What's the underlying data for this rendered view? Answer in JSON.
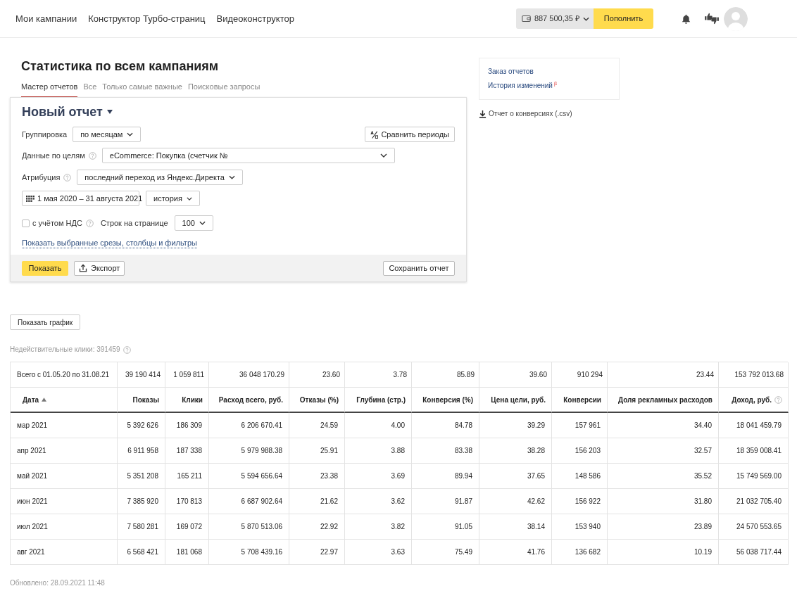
{
  "top_nav": {
    "links": [
      {
        "label": "Мои кампании"
      },
      {
        "label": "Конструктор Турбо-страниц"
      },
      {
        "label": "Видеоконструктор"
      }
    ],
    "balance": "887 500,35 ₽",
    "topup_button": "Пополнить"
  },
  "page": {
    "title": "Статистика по всем кампаниям",
    "tabs": [
      {
        "label": "Мастер отчетов",
        "selected": true
      },
      {
        "label": "Все",
        "selected": false
      },
      {
        "label": "Только самые важные",
        "selected": false
      },
      {
        "label": "Поисковые запросы",
        "selected": false
      }
    ]
  },
  "report_form": {
    "title": "Новый отчет",
    "grouping": {
      "label": "Группировка",
      "value": "по месяцам"
    },
    "compare_button": "Сравнить периоды",
    "goals": {
      "label": "Данные по целям",
      "value": "eCommerce: Покупка (счетчик №"
    },
    "attribution": {
      "label": "Атрибуция",
      "value": "последний переход из Яндекс.Директа"
    },
    "date_range": "1 мая 2020 – 31 августа 2021",
    "period_select": "история",
    "vat": {
      "label": "с учётом НДС",
      "checked": false
    },
    "rows_per_page": {
      "label": "Строк на странице",
      "value": "100"
    },
    "filters_link": "Показать выбранные срезы, столбцы и фильтры",
    "show_button": "Показать",
    "export_button": "Экспорт",
    "save_button": "Сохранить отчет"
  },
  "side_panel": {
    "links": [
      {
        "label": "Заказ отчетов"
      },
      {
        "label": "История изменений",
        "badge": "β"
      }
    ],
    "download_link": "Отчет о конверсиях (.csv)"
  },
  "show_chart_button": "Показать график",
  "invalid_clicks": "Недействительные клики: 391459",
  "table": {
    "totals": [
      "Всего с 01.05.20 по 31.08.21",
      "39 190 414",
      "1 059 811",
      "36 048 170.29",
      "23.60",
      "3.78",
      "85.89",
      "39.60",
      "910 294",
      "23.44",
      "153 792 013.68"
    ],
    "columns": [
      {
        "label": "Дата",
        "sorted": true,
        "help": false
      },
      {
        "label": "Показы",
        "sorted": false,
        "help": false
      },
      {
        "label": "Клики",
        "sorted": false,
        "help": false
      },
      {
        "label": "Расход всего, руб.",
        "sorted": false,
        "help": false
      },
      {
        "label": "Отказы (%)",
        "sorted": false,
        "help": false
      },
      {
        "label": "Глубина (стр.)",
        "sorted": false,
        "help": false
      },
      {
        "label": "Конверсия (%)",
        "sorted": false,
        "help": false
      },
      {
        "label": "Цена цели, руб.",
        "sorted": false,
        "help": false
      },
      {
        "label": "Конверсии",
        "sorted": false,
        "help": false
      },
      {
        "label": "Доля рекламных расходов",
        "sorted": false,
        "help": false
      },
      {
        "label": "Доход, руб.",
        "sorted": false,
        "help": true
      }
    ],
    "rows": [
      [
        "мар 2021",
        "5 392 626",
        "186 309",
        "6 206 670.41",
        "24.59",
        "4.00",
        "84.78",
        "39.29",
        "157 961",
        "34.40",
        "18 041 459.79"
      ],
      [
        "апр 2021",
        "6 911 958",
        "187 338",
        "5 979 988.38",
        "25.91",
        "3.88",
        "83.38",
        "38.28",
        "156 203",
        "32.57",
        "18 359 008.41"
      ],
      [
        "май 2021",
        "5 351 208",
        "165 211",
        "5 594 656.64",
        "23.38",
        "3.69",
        "89.94",
        "37.65",
        "148 586",
        "35.52",
        "15 749 569.00"
      ],
      [
        "июн 2021",
        "7 385 920",
        "170 813",
        "6 687 902.64",
        "21.62",
        "3.62",
        "91.87",
        "42.62",
        "156 922",
        "31.80",
        "21 032 705.40"
      ],
      [
        "июл 2021",
        "7 580 281",
        "169 072",
        "5 870 513.06",
        "22.92",
        "3.82",
        "91.05",
        "38.14",
        "153 940",
        "23.89",
        "24 570 553.65"
      ],
      [
        "авг 2021",
        "6 568 421",
        "181 068",
        "5 708 439.16",
        "22.97",
        "3.63",
        "75.49",
        "41.76",
        "136 682",
        "10.19",
        "56 038 717.44"
      ]
    ]
  },
  "updated": "Обновлено: 28.09.2021 11:48"
}
